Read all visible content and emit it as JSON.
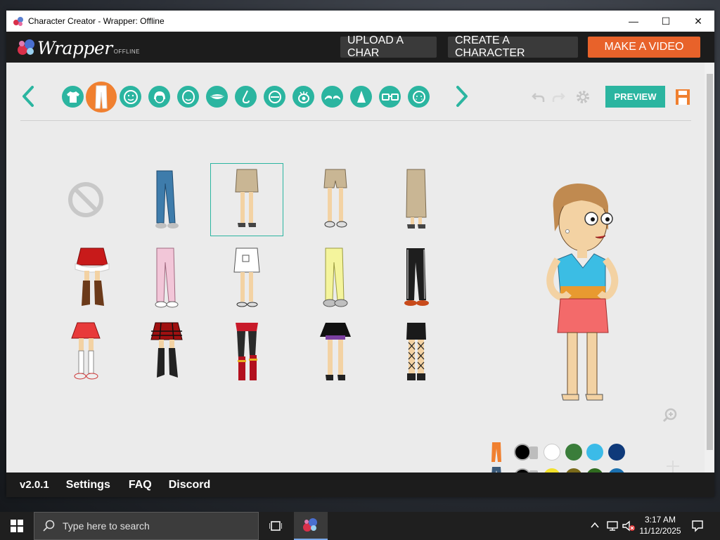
{
  "window": {
    "title": "Character Creator - Wrapper: Offline",
    "controls": [
      "—",
      "☐",
      "✕"
    ]
  },
  "appbar": {
    "logo_text": "Wrapper",
    "logo_sub": "OFFLINE",
    "upload_label": "UPLOAD A CHAR",
    "create_label": "CREATE A CHARACTER",
    "video_label": "MAKE A VIDEO"
  },
  "toolbar": {
    "categories": [
      "upper-body-icon",
      "lower-body-icon",
      "face-shape-icon",
      "hair-icon",
      "head-icon",
      "mouth-icon",
      "nose-icon",
      "eye-icon",
      "eyeball-icon",
      "eyebrow-icon",
      "ear-icon",
      "glasses-icon",
      "facial-feature-icon"
    ],
    "active_category": "lower-body-icon",
    "preview_label": "PREVIEW"
  },
  "items": {
    "rows": [
      [
        "none",
        "blue-jeans",
        "khaki-skirt",
        "khaki-shorts",
        "long-khaki-skirt"
      ],
      [
        "red-santa-skirt",
        "pink-pants",
        "white-skirt",
        "yellow-pants",
        "black-track-pants"
      ],
      [
        "red-mini-skirt",
        "plaid-skirt",
        "red-boots-outfit",
        "black-tutu",
        "fishnet-skirt"
      ]
    ],
    "selected": "khaki-skirt"
  },
  "colors": {
    "accent": "#2bb5a0",
    "orange": "#f08030",
    "row1": [
      "#000000",
      "#ffffff",
      "#3a7d3a",
      "#3bbbe8",
      "#0f3a7a"
    ],
    "row2": [
      "#000000",
      "#f2e02a",
      "#7a6a1a",
      "#2f6b1f",
      "#1a70b0"
    ]
  },
  "footer": {
    "version": "v2.0.1",
    "settings": "Settings",
    "faq": "FAQ",
    "discord": "Discord"
  },
  "taskbar": {
    "search_placeholder": "Type here to search",
    "time": "3:17 AM",
    "date": "11/12/2025"
  }
}
